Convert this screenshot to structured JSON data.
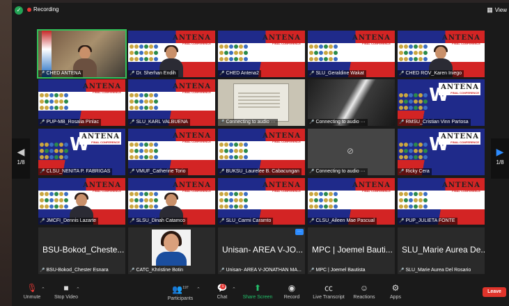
{
  "topbar": {
    "recording_label": "Recording",
    "view_label": "View",
    "shield_icon": "shield-check-icon",
    "view_icon": "grid-icon"
  },
  "pager": {
    "left_label": "1/8",
    "right_label": "1/8"
  },
  "participants": [
    {
      "name": "CHED ANTENA",
      "kind": "room"
    },
    {
      "name": "Dr. Sherhan Endih",
      "kind": "person"
    },
    {
      "name": "CHED Antena2",
      "kind": "slide"
    },
    {
      "name": "SLU_Geraldine Wakat",
      "kind": "slide"
    },
    {
      "name": "CHED ROV_Karen Iniego",
      "kind": "person"
    },
    {
      "name": "PUP-MB_Rosalia Pinlac",
      "kind": "slide"
    },
    {
      "name": "SLU_KARL VALBUENA",
      "kind": "slide"
    },
    {
      "name": "Connecting to audio ···",
      "kind": "poster"
    },
    {
      "name": "Connecting to audio ···",
      "kind": "grey"
    },
    {
      "name": "RMSU_Cristian Vinn Partosa",
      "kind": "blue"
    },
    {
      "name": "CLSU_NENITA P. FABRIGAS",
      "kind": "blue"
    },
    {
      "name": "VMUF_Catherine Torio",
      "kind": "slide"
    },
    {
      "name": "BUKSU_Laurelee B. Cabacungan",
      "kind": "slide"
    },
    {
      "name": "Connecting to audio ···",
      "kind": "camoff"
    },
    {
      "name": "Ricky Cera",
      "kind": "blue"
    },
    {
      "name": "JMCFI_Dennis Lazarte",
      "kind": "person"
    },
    {
      "name": "SLSU_Dinah Catamco",
      "kind": "person"
    },
    {
      "name": "SLU_Carmi Caramto",
      "kind": "slide"
    },
    {
      "name": "CLSU_Aileen Mae Pascual",
      "kind": "slide"
    },
    {
      "name": "PUP_JULIETA FONTE",
      "kind": "slide"
    },
    {
      "name": "BSU-Bokod_Chester Esnara",
      "kind": "dark",
      "display": "BSU-Bokod_Cheste..."
    },
    {
      "name": "CATC_Khristine Botin",
      "kind": "photo"
    },
    {
      "name": "Unisan- AREA V-JONATHAN MA...",
      "kind": "dark",
      "display": "Unisan- AREA V-JO..."
    },
    {
      "name": "MPC | Joemel Bautista",
      "kind": "dark",
      "display": "MPC | Joemel Bauti..."
    },
    {
      "name": "SLU_Marie Aurea Del Rosario",
      "kind": "dark",
      "display": "SLU_Marie Aurea De..."
    }
  ],
  "slide": {
    "title": "ANTENA",
    "subtitle": "FINAL CONFERENCE"
  },
  "toolbar": {
    "unmute": "Unmute",
    "stop_video": "Stop Video",
    "participants": "Participants",
    "participant_count": "197",
    "chat": "Chat",
    "chat_badge": "1",
    "share_screen": "Share Screen",
    "record": "Record",
    "live_transcript": "Live Transcript",
    "reactions": "Reactions",
    "apps": "Apps",
    "leave": "Leave"
  },
  "colors": {
    "share_green": "#23c26b",
    "leave_red": "#e0342b",
    "active_speaker": "#32c25a",
    "nav_blue": "#2d8cff"
  }
}
